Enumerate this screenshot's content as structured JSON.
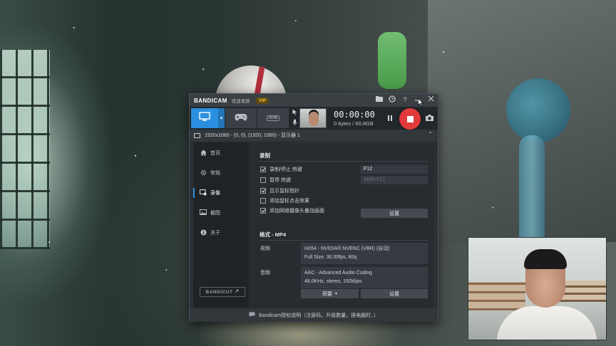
{
  "app": {
    "logo": "BANDICAM",
    "logo_sub": "班迪录屏",
    "badge": "VIP"
  },
  "titlebar": {
    "icons": [
      "folder-icon",
      "clock-icon",
      "help-icon",
      "minimize-icon",
      "close-icon"
    ]
  },
  "toolbar": {
    "modes": [
      {
        "name": "screen-record-mode",
        "icon": "monitor-icon",
        "active": true
      },
      {
        "name": "game-record-mode",
        "icon": "gamepad-icon",
        "active": false
      },
      {
        "name": "device-record-mode",
        "icon": "hdmi-icon",
        "label": "HDMI",
        "active": false
      }
    ],
    "timer": "00:00:00",
    "filesize": "0 bytes / 60.8GB"
  },
  "target": {
    "text": "1920x1080 - (0, 0), (1920, 1080) - 显示器 1"
  },
  "sidebar": {
    "items": [
      {
        "label": "首页",
        "icon": "home-icon",
        "active": false
      },
      {
        "label": "常规",
        "icon": "gear-icon",
        "active": false
      },
      {
        "label": "录像",
        "icon": "video-icon",
        "active": true
      },
      {
        "label": "截图",
        "icon": "image-icon",
        "active": false
      },
      {
        "label": "关于",
        "icon": "info-icon",
        "active": false
      }
    ],
    "bandicut": "BANDICUT"
  },
  "record": {
    "title": "录制",
    "options": [
      {
        "label": "录制/停止 热键",
        "checked": true,
        "hotkey": "F12"
      },
      {
        "label": "暂停 热键",
        "checked": false,
        "hotkey": "Shift+F12"
      },
      {
        "label": "显示鼠标指针",
        "checked": true
      },
      {
        "label": "添加鼠标点击效果",
        "checked": false
      },
      {
        "label": "添加网络摄像头叠加画面",
        "checked": true
      }
    ],
    "settings_button": "设置"
  },
  "format": {
    "title": "格式 - MP4",
    "video_label": "视频",
    "video_line1": "H264 - NVIDIA® NVENC (VBR) (自动)",
    "video_line2": "Full Size, 30.00fps, 80q",
    "audio_label": "音频",
    "audio_line1": "AAC - Advanced Audio Coding",
    "audio_line2": "48.0KHz, stereo, 192kbps",
    "preset_button": "预置",
    "settings_button": "设置"
  },
  "status": {
    "text": "Bandicam授权说明（注册码，升级数量，换电脑时..）"
  },
  "colors": {
    "accent": "#2b8fe0",
    "record": "#e23b3b",
    "vip": "#f2c233"
  }
}
